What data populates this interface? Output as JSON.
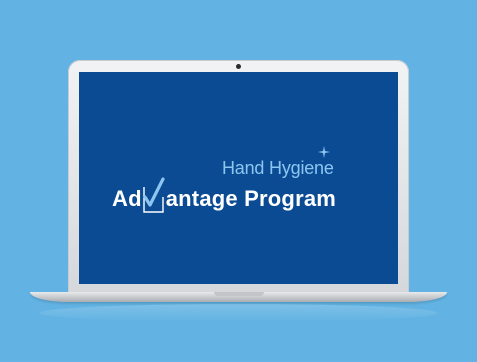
{
  "logo": {
    "line1": "Hand Hygiene",
    "line2_before": "Ad",
    "line2_after": "antage Program"
  },
  "colors": {
    "background": "#62b3e3",
    "screen": "#0b4b93",
    "accent_light_blue": "#8cc6f0",
    "text_white": "#ffffff"
  },
  "icons": {
    "logo_mark": "checkbox-checkmark-icon",
    "decoration": "sparkle-icon",
    "webcam": "camera-icon"
  }
}
